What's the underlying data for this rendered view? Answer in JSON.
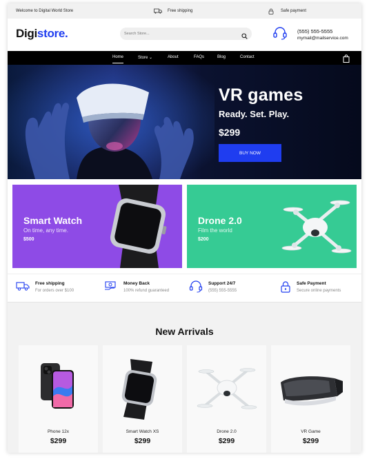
{
  "topbar": {
    "welcome": "Welcome to Digital World Store",
    "shipping": "Free shipping",
    "safe_payment": "Safe payment"
  },
  "header": {
    "logo_part1": "Digi",
    "logo_part2": "store.",
    "search_placeholder": "Search Store...",
    "phone": "(555) 555-5555",
    "email": "mymail@mailservice.com"
  },
  "nav": {
    "items": [
      "Home",
      "Store",
      "About",
      "FAQs",
      "Blog",
      "Contact"
    ],
    "active": "Home"
  },
  "hero": {
    "title": "VR games",
    "subtitle": "Ready. Set. Play.",
    "price": "$299",
    "button": "BUY NOW"
  },
  "promos": [
    {
      "title": "Smart Watch",
      "subtitle": "On time, any time.",
      "price": "$500",
      "color": "#8e4be6"
    },
    {
      "title": "Drone 2.0",
      "subtitle": "Film the world",
      "price": "$200",
      "color": "#36cb94"
    }
  ],
  "features": [
    {
      "title": "Free shipping",
      "subtitle": "For orders over $100",
      "icon": "truck-icon"
    },
    {
      "title": "Money Back",
      "subtitle": "100% refund guaranteed",
      "icon": "money-back-icon"
    },
    {
      "title": "Support 24/7",
      "subtitle": "(555) 555-5555",
      "icon": "headset-icon"
    },
    {
      "title": "Safe Payment",
      "subtitle": "Secure online payments",
      "icon": "lock-icon"
    }
  ],
  "arrivals": {
    "heading": "New Arrivals",
    "products": [
      {
        "name": "Phone 12x",
        "price": "$299"
      },
      {
        "name": "Smart Watch XS",
        "price": "$299"
      },
      {
        "name": "Drone 2.0",
        "price": "$299"
      },
      {
        "name": "VR Game",
        "price": "$299"
      }
    ]
  },
  "colors": {
    "accent": "#1f3df0",
    "nav_bg": "#000000",
    "watch_promo": "#8e4be6",
    "drone_promo": "#36cb94"
  }
}
